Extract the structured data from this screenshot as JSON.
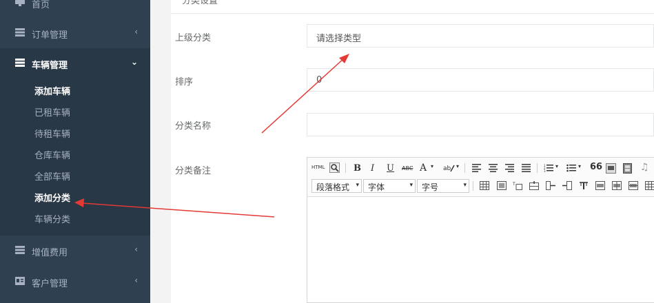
{
  "sidebar": {
    "items": [
      {
        "label": "首页",
        "icon": "monitor-icon"
      },
      {
        "label": "订单管理",
        "icon": "list-icon",
        "chevron": "‹"
      },
      {
        "label": "车辆管理",
        "icon": "list-icon",
        "chevron": "⌄"
      },
      {
        "label": "增值费用",
        "icon": "list-icon",
        "chevron": "‹"
      },
      {
        "label": "客户管理",
        "icon": "id-card-icon",
        "chevron": "‹"
      }
    ],
    "submenu": [
      "添加车辆",
      "已租车辆",
      "待租车辆",
      "仓库车辆",
      "全部车辆",
      "添加分类",
      "车辆分类"
    ]
  },
  "form": {
    "title": "分类设置",
    "parent_label": "上级分类",
    "parent_value": "请选择类型",
    "sort_label": "排序",
    "sort_value": "0",
    "name_label": "分类名称",
    "name_value": "",
    "remark_label": "分类备注"
  },
  "editor": {
    "html_label": "HTML",
    "bold": "B",
    "italic": "I",
    "underline": "U",
    "strike": "ABC",
    "font_color": "A",
    "quote": "66",
    "paragraph_select": "段落格式",
    "font_select": "字体",
    "size_select": "字号"
  },
  "colors": {
    "sidebar_bg": "#2f4050",
    "active_bg": "#293846",
    "annotation_arrow": "#e53935"
  }
}
